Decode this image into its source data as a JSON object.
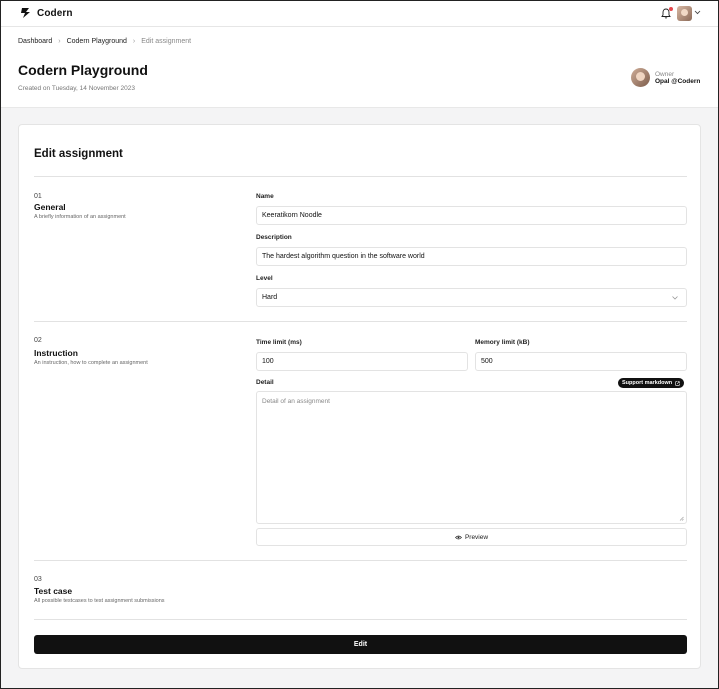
{
  "nav": {
    "brand": "Codern",
    "notification_icon": "bell-icon",
    "accent_notification": "#e5484d"
  },
  "breadcrumb": {
    "items": [
      "Dashboard",
      "Codern Playground",
      "Edit assignment"
    ]
  },
  "header": {
    "title": "Codern Playground",
    "created": "Created on Tuesday, 14 November 2023",
    "owner_label": "Owner",
    "owner_name": "Opal @Codern"
  },
  "form": {
    "title": "Edit assignment",
    "sections": [
      {
        "num": "01",
        "title": "General",
        "desc": "A briefly information of an assignment"
      },
      {
        "num": "02",
        "title": "Instruction",
        "desc": "An instruction, how to complete an assignment"
      },
      {
        "num": "03",
        "title": "Test case",
        "desc": "All possible testcases to test assignment submissions"
      }
    ],
    "name": {
      "label": "Name",
      "value": "Keeratikorn Noodle"
    },
    "description": {
      "label": "Description",
      "value": "The hardest algorithm question in the software world"
    },
    "level": {
      "label": "Level",
      "value": "Hard"
    },
    "time_limit": {
      "label": "Time limit (ms)",
      "value": "100"
    },
    "memory_limit": {
      "label": "Memory limit (kB)",
      "value": "500"
    },
    "detail": {
      "label": "Detail",
      "placeholder": "Detail of an assignment",
      "markdown_badge": "Support markdown"
    },
    "preview_label": "Preview",
    "submit_label": "Edit"
  }
}
